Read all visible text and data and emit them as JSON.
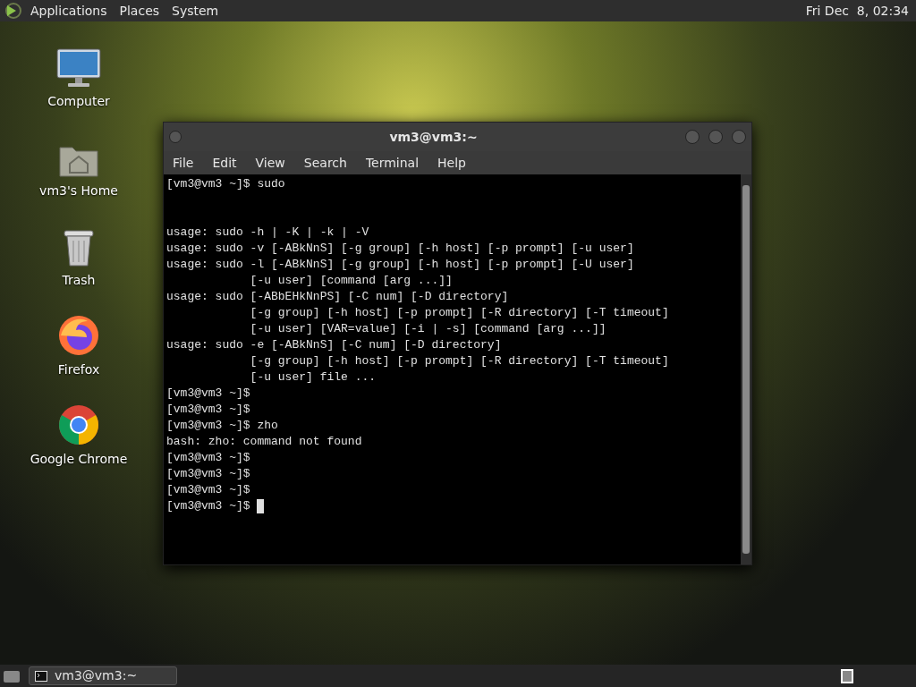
{
  "top_panel": {
    "menus": [
      "Applications",
      "Places",
      "System"
    ],
    "clock": "Fri Dec  8, 02:34"
  },
  "desktop_icons": [
    {
      "kind": "computer",
      "label": "Computer"
    },
    {
      "kind": "home",
      "label": "vm3's Home"
    },
    {
      "kind": "trash",
      "label": "Trash"
    },
    {
      "kind": "firefox",
      "label": "Firefox"
    },
    {
      "kind": "chrome",
      "label": "Google Chrome"
    }
  ],
  "window": {
    "title": "vm3@vm3:~",
    "menu": [
      "File",
      "Edit",
      "View",
      "Search",
      "Terminal",
      "Help"
    ],
    "lines": [
      {
        "text": "[vm3@vm3 ~]$ sudo",
        "gap_before": false,
        "cursor": false
      },
      {
        "text": "usage: sudo -h | -K | -k | -V",
        "gap_before": true,
        "cursor": false
      },
      {
        "text": "usage: sudo -v [-ABkNnS] [-g group] [-h host] [-p prompt] [-u user]",
        "gap_before": false,
        "cursor": false
      },
      {
        "text": "usage: sudo -l [-ABkNnS] [-g group] [-h host] [-p prompt] [-U user]",
        "gap_before": false,
        "cursor": false
      },
      {
        "text": "            [-u user] [command [arg ...]]",
        "gap_before": false,
        "cursor": false
      },
      {
        "text": "usage: sudo [-ABbEHkNnPS] [-C num] [-D directory]",
        "gap_before": false,
        "cursor": false
      },
      {
        "text": "            [-g group] [-h host] [-p prompt] [-R directory] [-T timeout]",
        "gap_before": false,
        "cursor": false
      },
      {
        "text": "            [-u user] [VAR=value] [-i | -s] [command [arg ...]]",
        "gap_before": false,
        "cursor": false
      },
      {
        "text": "usage: sudo -e [-ABkNnS] [-C num] [-D directory]",
        "gap_before": false,
        "cursor": false
      },
      {
        "text": "            [-g group] [-h host] [-p prompt] [-R directory] [-T timeout]",
        "gap_before": false,
        "cursor": false
      },
      {
        "text": "            [-u user] file ...",
        "gap_before": false,
        "cursor": false
      },
      {
        "text": "[vm3@vm3 ~]$",
        "gap_before": false,
        "cursor": false
      },
      {
        "text": "[vm3@vm3 ~]$",
        "gap_before": false,
        "cursor": false
      },
      {
        "text": "[vm3@vm3 ~]$ zho",
        "gap_before": false,
        "cursor": false
      },
      {
        "text": "bash: zho: command not found",
        "gap_before": false,
        "cursor": false
      },
      {
        "text": "[vm3@vm3 ~]$",
        "gap_before": false,
        "cursor": false
      },
      {
        "text": "[vm3@vm3 ~]$",
        "gap_before": false,
        "cursor": false
      },
      {
        "text": "[vm3@vm3 ~]$",
        "gap_before": false,
        "cursor": false
      },
      {
        "text": "[vm3@vm3 ~]$ ",
        "gap_before": false,
        "cursor": true
      }
    ]
  },
  "taskbar": {
    "tasks": [
      {
        "label": "vm3@vm3:~",
        "selected": false
      }
    ]
  }
}
